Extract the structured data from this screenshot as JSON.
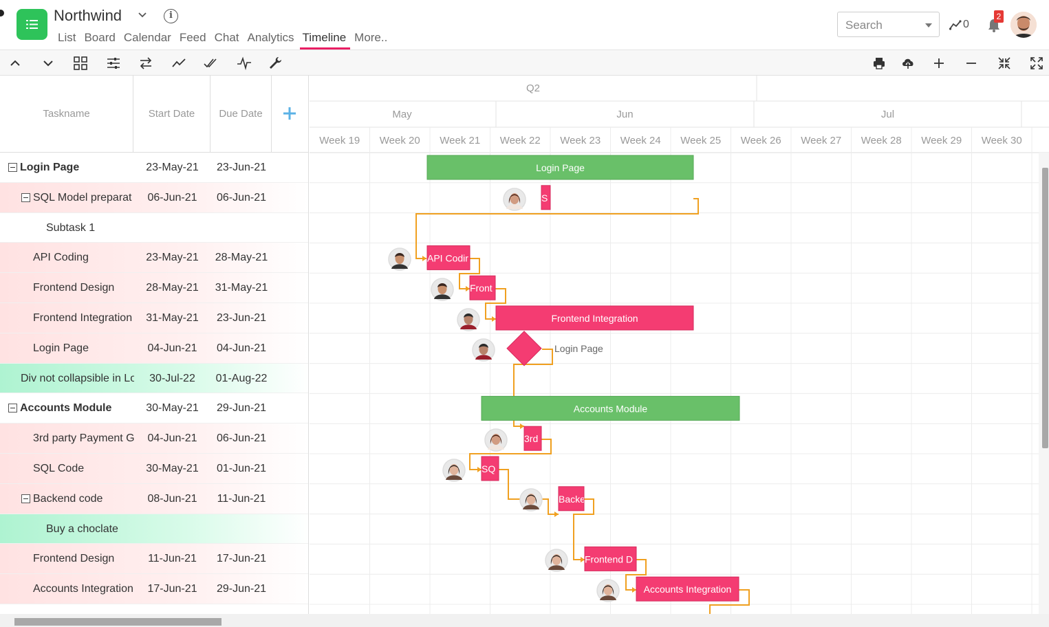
{
  "header": {
    "title": "Northwind",
    "nav_tabs": [
      {
        "label": "List"
      },
      {
        "label": "Board"
      },
      {
        "label": "Calendar"
      },
      {
        "label": "Feed"
      },
      {
        "label": "Chat"
      },
      {
        "label": "Analytics"
      },
      {
        "label": "Timeline",
        "active": true
      },
      {
        "label": "More.."
      }
    ],
    "search_placeholder": "Search",
    "activity_count": "0",
    "notification_count": "2"
  },
  "toolbar": {
    "left_icons": [
      "chevron-up-icon",
      "chevron-down-icon",
      "grid-icon",
      "sliders-icon",
      "swap-icon",
      "trend-icon",
      "double-check-icon",
      "pulse-icon",
      "wrench-icon"
    ],
    "right_icons": [
      "print-icon",
      "cloud-upload-icon",
      "zoom-in-icon",
      "zoom-out-icon",
      "collapse-icon",
      "expand-icon"
    ]
  },
  "grid": {
    "columns": {
      "taskname": "Taskname",
      "start": "Start Date",
      "due": "Due Date"
    },
    "rows": [
      {
        "name": "Login Page",
        "start": "23-May-21",
        "due": "23-Jun-21",
        "level": 0,
        "bold": true,
        "toggle": true,
        "bg": "white"
      },
      {
        "name": "SQL Model preparat",
        "start": "06-Jun-21",
        "due": "06-Jun-21",
        "level": 1,
        "toggle": true,
        "bg": "pink"
      },
      {
        "name": "Subtask 1",
        "start": "",
        "due": "",
        "level": 2,
        "bg": "white"
      },
      {
        "name": "API Coding",
        "start": "23-May-21",
        "due": "28-May-21",
        "level": 1,
        "bg": "pink"
      },
      {
        "name": "Frontend Design",
        "start": "28-May-21",
        "due": "31-May-21",
        "level": 1,
        "bg": "pink"
      },
      {
        "name": "Frontend Integration",
        "start": "31-May-21",
        "due": "23-Jun-21",
        "level": 1,
        "bg": "pink"
      },
      {
        "name": "Login Page",
        "start": "04-Jun-21",
        "due": "04-Jun-21",
        "level": 1,
        "bg": "pink"
      },
      {
        "name": "Div not collapsible in Lo",
        "start": "30-Jul-22",
        "due": "01-Aug-22",
        "level": 0.5,
        "bg": "green"
      },
      {
        "name": "Accounts Module",
        "start": "30-May-21",
        "due": "29-Jun-21",
        "level": 0,
        "bold": true,
        "toggle": true,
        "bg": "white"
      },
      {
        "name": "3rd party Payment G",
        "start": "04-Jun-21",
        "due": "06-Jun-21",
        "level": 1,
        "bg": "pink"
      },
      {
        "name": "SQL Code",
        "start": "30-May-21",
        "due": "01-Jun-21",
        "level": 1,
        "bg": "pink"
      },
      {
        "name": "Backend code",
        "start": "08-Jun-21",
        "due": "11-Jun-21",
        "level": 1,
        "toggle": true,
        "bg": "pink"
      },
      {
        "name": "Buy a choclate",
        "start": "",
        "due": "",
        "level": 2,
        "bg": "green"
      },
      {
        "name": "Frontend Design",
        "start": "11-Jun-21",
        "due": "17-Jun-21",
        "level": 1,
        "bg": "pink"
      },
      {
        "name": "Accounts Integration",
        "start": "17-Jun-21",
        "due": "29-Jun-21",
        "level": 1,
        "bg": "pink"
      }
    ]
  },
  "timeline": {
    "quarter": "Q2",
    "months": [
      "May",
      "Jun",
      "Jul"
    ],
    "weeks": [
      "Week 19",
      "Week 20",
      "Week 21",
      "Week 22",
      "Week 23",
      "Week 24",
      "Week 25",
      "Week 26",
      "Week 27",
      "Week 28",
      "Week 29",
      "Week 30"
    ],
    "bars": [
      {
        "row": 0,
        "label": "Login Page",
        "kind": "summary"
      },
      {
        "row": 1,
        "label": "S",
        "kind": "task",
        "avatar": "woman-1"
      },
      {
        "row": 3,
        "label": "API Codir",
        "kind": "task",
        "avatar": "man-1"
      },
      {
        "row": 4,
        "label": "Front",
        "kind": "task",
        "avatar": "man-1"
      },
      {
        "row": 5,
        "label": "Frontend Integration",
        "kind": "task",
        "avatar": "man-2"
      },
      {
        "row": 6,
        "label": "Login Page",
        "kind": "milestone",
        "avatar": "man-2"
      },
      {
        "row": 8,
        "label": "Accounts Module",
        "kind": "summary"
      },
      {
        "row": 9,
        "label": "3rd",
        "kind": "task",
        "avatar": "woman-1"
      },
      {
        "row": 10,
        "label": "SQ",
        "kind": "task",
        "avatar": "woman-2"
      },
      {
        "row": 11,
        "label": "Backe",
        "kind": "task",
        "avatar": "woman-2"
      },
      {
        "row": 13,
        "label": "Frontend D",
        "kind": "task",
        "avatar": "woman-2"
      },
      {
        "row": 14,
        "label": "Accounts Integration",
        "kind": "task",
        "avatar": "woman-2"
      }
    ],
    "colors": {
      "summary": "#69c069",
      "task": "#f43c72",
      "connector": "#f0a020"
    }
  }
}
